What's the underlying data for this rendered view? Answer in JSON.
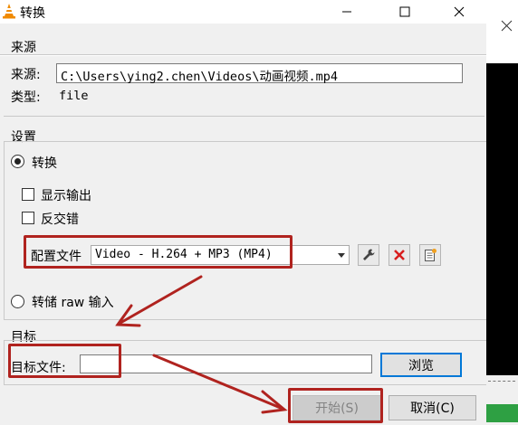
{
  "window": {
    "title": "转换"
  },
  "source": {
    "group_title": "来源",
    "source_label": "来源:",
    "source_value": "C:\\Users\\ying2.chen\\Videos\\动画视频.mp4",
    "type_label": "类型:",
    "type_value": "file"
  },
  "settings": {
    "group_title": "设置",
    "convert_label": "转换",
    "show_output_label": "显示输出",
    "deinterlace_label": "反交错",
    "profile_label": "配置文件",
    "profile_value": "Video - H.264 + MP3 (MP4)",
    "dump_raw_label": "转储 raw 输入"
  },
  "target": {
    "group_title": "目标",
    "dest_label": "目标文件:",
    "dest_value": "",
    "browse_label": "浏览"
  },
  "actions": {
    "start_label": "开始(S)",
    "cancel_label": "取消(C)"
  },
  "colors": {
    "highlight": "#b0231f",
    "focus": "#0078d7"
  }
}
